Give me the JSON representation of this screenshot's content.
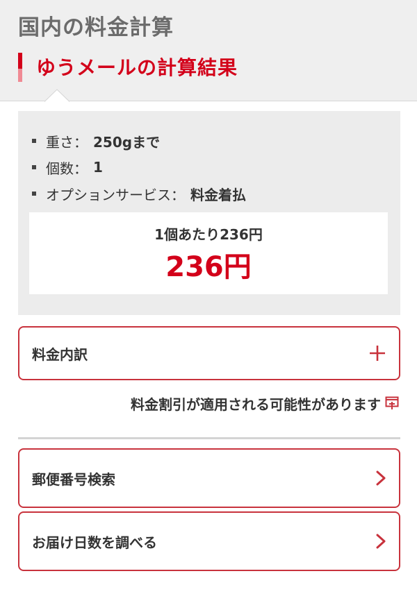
{
  "header": {
    "title": "国内の料金計算",
    "section_title": "ゆうメールの計算結果"
  },
  "summary": {
    "items": [
      {
        "label": "重さ：",
        "value": "250gまで"
      },
      {
        "label": "個数：",
        "value": "1"
      },
      {
        "label": "オプションサービス：",
        "value": "料金着払"
      }
    ],
    "per_unit_text": "1個あたり236円",
    "total_price": "236円"
  },
  "breakdown": {
    "label": "料金内訳",
    "icon": "plus-icon"
  },
  "discount_note": {
    "text": "料金割引が適用される可能性があります",
    "icon": "external-window-icon"
  },
  "links": [
    {
      "label": "郵便番号検索",
      "icon": "chevron-right-icon"
    },
    {
      "label": "お届け日数を調べる",
      "icon": "chevron-right-icon"
    }
  ],
  "colors": {
    "accent": "#d3001a",
    "header_bg": "#efefef",
    "panel_bg": "#ececec",
    "border": "#c8323c"
  }
}
